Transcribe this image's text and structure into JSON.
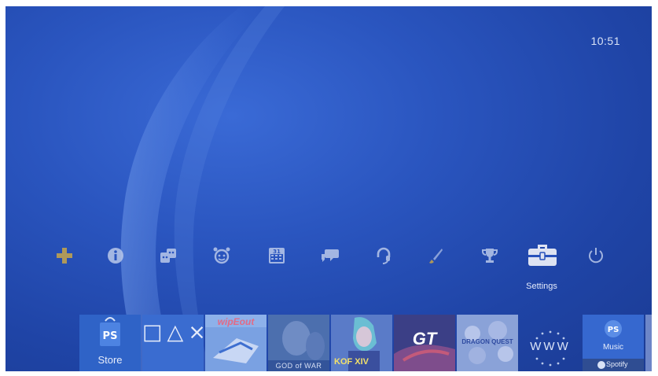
{
  "status": {
    "clock": "10:51"
  },
  "function_area": {
    "items": [
      {
        "name": "ps-plus-icon"
      },
      {
        "name": "info-icon"
      },
      {
        "name": "friends-icon"
      },
      {
        "name": "party-icon"
      },
      {
        "name": "calendar-icon",
        "glyph_text": "31"
      },
      {
        "name": "messages-icon"
      },
      {
        "name": "headset-icon"
      },
      {
        "name": "brush-icon"
      },
      {
        "name": "trophy-icon"
      },
      {
        "name": "toolbox-icon"
      },
      {
        "name": "power-icon"
      }
    ],
    "selected_label": "Settings"
  },
  "content_area": {
    "store_label": "Store",
    "library_symbols": "□△×○",
    "wipeout_title": "wipEout",
    "god_of_war_title": "GOD of WAR",
    "kof_title": "KOF XIV",
    "gt_title": "GT",
    "dragon_title": "DRAGON QUEST",
    "www_label": "WWW",
    "music_label": "Music",
    "spotify_label": "Spotify"
  },
  "colors": {
    "background": "#2450b5",
    "icon": "#b9c8ea",
    "selected_icon": "#ffffff",
    "psplus": "#c7a64a"
  }
}
